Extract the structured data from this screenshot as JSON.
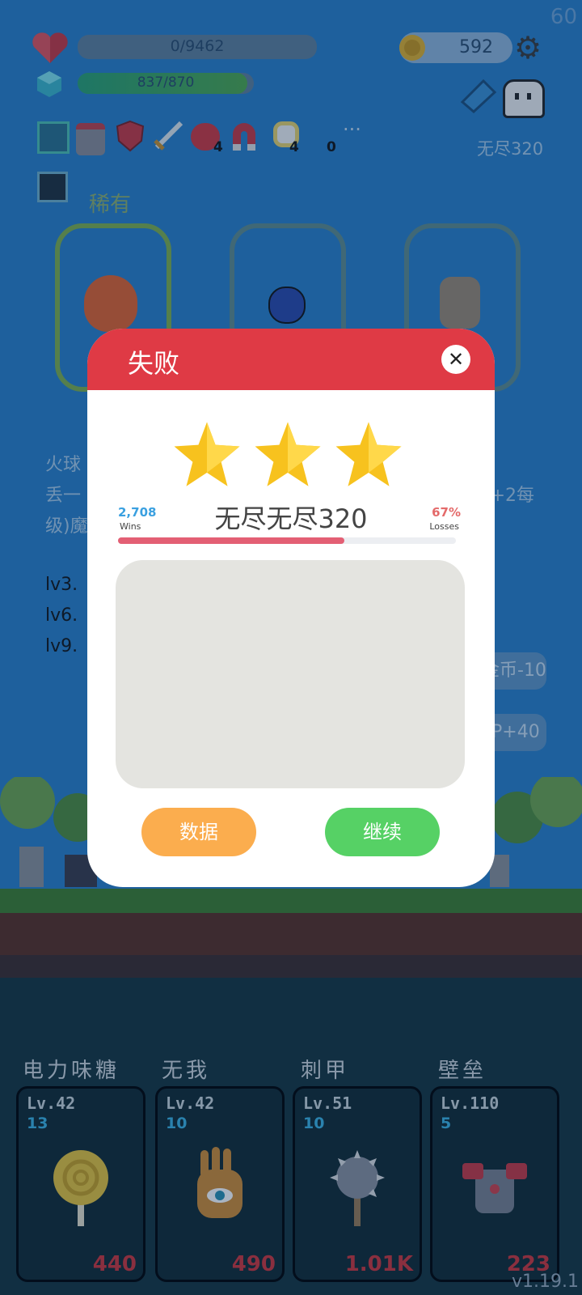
{
  "hud": {
    "fps": "60",
    "hp_text": "0/9462",
    "hp_fraction": 0,
    "xp_text": "837/870",
    "xp_fraction": 0.962,
    "coins": "592",
    "mode_label": "无尽320",
    "buff_counts": {
      "apple": "4",
      "flower": "4",
      "extra": "0"
    },
    "more_label": "···"
  },
  "background": {
    "rarity_label": "稀有",
    "desc_lines": [
      "火球",
      "丢一",
      "级)魔"
    ],
    "desc_right": "(+2每",
    "level_lines": [
      "lv3.",
      "lv6.",
      "lv9."
    ],
    "side_buttons": [
      "金币-10",
      "P+40"
    ]
  },
  "modal": {
    "title": "失败",
    "close_glyph": "✕",
    "stars": 3,
    "wins_value": "2,708",
    "wins_label": "Wins",
    "losses_value": "67%",
    "losses_label": "Losses",
    "mode_title": "无尽无尽320",
    "progress_fraction": 0.67,
    "btn_data": "数据",
    "btn_continue": "继续",
    "colors": {
      "header": "#df3a45",
      "data_btn": "#fbad4e",
      "continue_btn": "#56d165"
    }
  },
  "cards": [
    {
      "name": "电力味糖",
      "level": "Lv.42",
      "count": "13",
      "power": "440",
      "icon": "lollipop-icon"
    },
    {
      "name": "无我",
      "level": "Lv.42",
      "count": "10",
      "power": "490",
      "icon": "eye-hand-icon"
    },
    {
      "name": "刺甲",
      "level": "Lv.51",
      "count": "10",
      "power": "1.01K",
      "icon": "spiked-ball-icon"
    },
    {
      "name": "壁垒",
      "level": "Lv.110",
      "count": "5",
      "power": "223",
      "icon": "armor-icon"
    }
  ],
  "version": "v1.19.1"
}
